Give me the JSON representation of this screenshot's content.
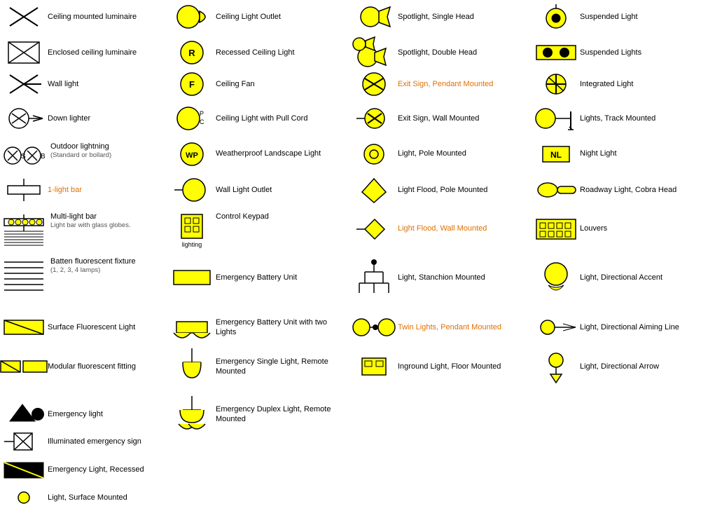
{
  "items": [
    {
      "id": "ceiling-mounted-luminaire",
      "label": "Ceiling mounted luminaire",
      "col": 1
    },
    {
      "id": "ceiling-light-outlet",
      "label": "Ceiling Light Outlet",
      "col": 2
    },
    {
      "id": "spotlight-single-head",
      "label": "Spotlight, Single Head",
      "col": 3
    },
    {
      "id": "suspended-light",
      "label": "Suspended Light",
      "col": 4
    },
    {
      "id": "enclosed-ceiling-luminaire",
      "label": "Enclosed ceiling luminaire",
      "col": 1
    },
    {
      "id": "recessed-ceiling-light",
      "label": "Recessed Ceiling Light",
      "col": 2
    },
    {
      "id": "spotlight-double-head",
      "label": "Spotlight, Double Head",
      "col": 3
    },
    {
      "id": "suspended-lights",
      "label": "Suspended Lights",
      "col": 4
    },
    {
      "id": "wall-light",
      "label": "Wall light",
      "col": 1
    },
    {
      "id": "ceiling-fan",
      "label": "Ceiling Fan",
      "col": 2
    },
    {
      "id": "exit-sign-pendant",
      "label": "Exit Sign, Pendant Mounted",
      "col": 3,
      "orange": true
    },
    {
      "id": "integrated-light",
      "label": "Integrated Light",
      "col": 4
    },
    {
      "id": "down-lighter",
      "label": "Down lighter",
      "col": 1
    },
    {
      "id": "ceiling-light-pull-cord",
      "label": "Ceiling Light with Pull Cord",
      "col": 2
    },
    {
      "id": "exit-sign-wall",
      "label": "Exit Sign, Wall Mounted",
      "col": 3
    },
    {
      "id": "lights-track-mounted",
      "label": "Lights, Track Mounted",
      "col": 4
    },
    {
      "id": "outdoor-lightning",
      "label": "Outdoor lightning",
      "sublabel": "(Standard or bollard)",
      "col": 1
    },
    {
      "id": "weatherproof-landscape",
      "label": "Weatherproof Landscape Light",
      "col": 2
    },
    {
      "id": "light-pole-mounted",
      "label": "Light, Pole Mounted",
      "col": 3
    },
    {
      "id": "night-light",
      "label": "Night Light",
      "col": 4
    },
    {
      "id": "1-light-bar",
      "label": "1-light bar",
      "col": 1,
      "orange": true
    },
    {
      "id": "wall-light-outlet",
      "label": "Wall Light Outlet",
      "col": 2
    },
    {
      "id": "light-flood-pole",
      "label": "Light Flood, Pole Mounted",
      "col": 3
    },
    {
      "id": "roadway-light-cobra",
      "label": "Roadway Light, Cobra Head",
      "col": 4
    },
    {
      "id": "multi-light-bar",
      "label": "Multi-light bar",
      "sublabel": "Light bar with glass globes.",
      "col": 1
    },
    {
      "id": "control-keypad",
      "label": "Control Keypad",
      "sublabel": "lighting",
      "col": 2
    },
    {
      "id": "light-flood-wall",
      "label": "Light Flood, Wall Mounted",
      "col": 3,
      "orange": true
    },
    {
      "id": "louvers",
      "label": "Louvers",
      "col": 4
    },
    {
      "id": "batten-fluorescent",
      "label": "Batten fluorescent fixture",
      "sublabel": "(1, 2, 3, 4 lamps)",
      "col": 1
    },
    {
      "id": "emergency-battery",
      "label": "Emergency Battery Unit",
      "col": 2
    },
    {
      "id": "light-stanchion",
      "label": "Light, Stanchion Mounted",
      "col": 3
    },
    {
      "id": "light-directional-accent",
      "label": "Light, Directional Accent",
      "col": 4
    },
    {
      "id": "surface-fluorescent",
      "label": "Surface Fluorescent Light",
      "col": 1
    },
    {
      "id": "emergency-battery-two",
      "label": "Emergency Battery Unit with two Lights",
      "col": 2
    },
    {
      "id": "twin-lights-pendant",
      "label": "Twin Lights, Pendant Mounted",
      "col": 3,
      "orange": true
    },
    {
      "id": "light-directional-aiming",
      "label": "Light, Directional Aiming Line",
      "col": 4
    },
    {
      "id": "modular-fluorescent",
      "label": "Modular fluorescent fitting",
      "col": 1
    },
    {
      "id": "emergency-single-light",
      "label": "Emergency Single Light, Remote Mounted",
      "col": 2
    },
    {
      "id": "inground-light",
      "label": "Inground Light, Floor Mounted",
      "col": 3
    },
    {
      "id": "light-directional-arrow",
      "label": "Light, Directional Arrow",
      "col": 4
    },
    {
      "id": "emergency-light",
      "label": "Emergency light",
      "col": 1
    },
    {
      "id": "emergency-duplex",
      "label": "Emergency Duplex Light, Remote Mounted",
      "col": 2
    },
    {
      "id": "illuminated-emergency",
      "label": "Illuminated emergency sign",
      "col": 1
    },
    {
      "id": "emergency-light-recessed",
      "label": "Emergency Light, Recessed",
      "col": 1
    },
    {
      "id": "light-surface-mounted",
      "label": "Light, Surface Mounted",
      "col": 1
    }
  ]
}
